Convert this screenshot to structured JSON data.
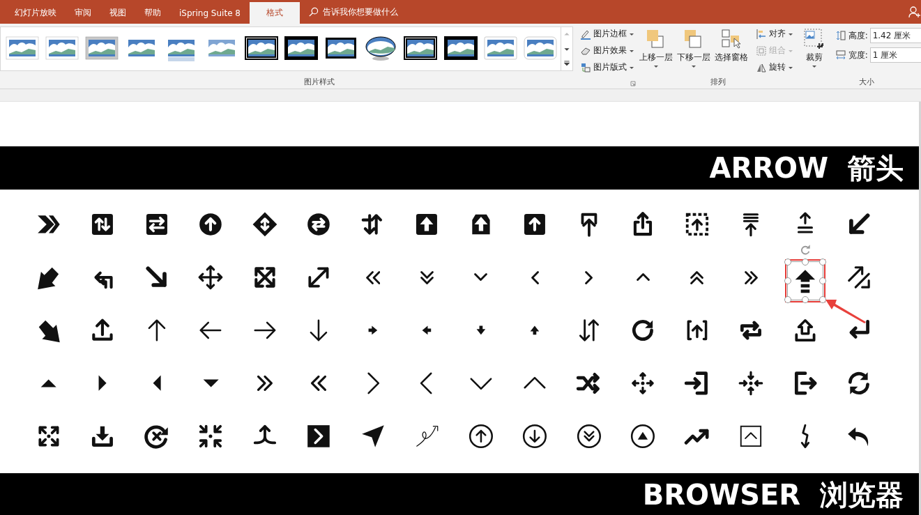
{
  "tabs": [
    {
      "label": "幻灯片放映",
      "selected": false
    },
    {
      "label": "审阅",
      "selected": false
    },
    {
      "label": "视图",
      "selected": false
    },
    {
      "label": "帮助",
      "selected": false
    },
    {
      "label": "iSpring Suite 8",
      "selected": false
    },
    {
      "label": "格式",
      "selected": true
    }
  ],
  "tell_me": {
    "placeholder": "告诉我你想要做什么"
  },
  "ribbon": {
    "picture_styles": {
      "label": "图片样式",
      "styles": [
        {
          "kind": "shadow"
        },
        {
          "kind": "white-frame"
        },
        {
          "kind": "gray-matte"
        },
        {
          "kind": "top-shadow"
        },
        {
          "kind": "reflection"
        },
        {
          "kind": "soft-edge"
        },
        {
          "kind": "double-black"
        },
        {
          "kind": "thick-black"
        },
        {
          "kind": "thin-black"
        },
        {
          "kind": "oval"
        },
        {
          "kind": "double-black"
        },
        {
          "kind": "thick-black"
        },
        {
          "kind": "plain"
        },
        {
          "kind": "rounded"
        }
      ],
      "commands": [
        {
          "label": "图片边框",
          "kind": "border"
        },
        {
          "label": "图片效果",
          "kind": "effects"
        },
        {
          "label": "图片版式",
          "kind": "layout"
        }
      ]
    },
    "arrange": {
      "label": "排列",
      "layers": [
        {
          "label": "上移一层",
          "kind": "forward"
        },
        {
          "label": "下移一层",
          "kind": "backward"
        },
        {
          "label": "选择窗格",
          "kind": "pane"
        }
      ],
      "commands": [
        {
          "label": "对齐",
          "kind": "align",
          "disabled": false
        },
        {
          "label": "组合",
          "kind": "group",
          "disabled": true
        },
        {
          "label": "旋转",
          "kind": "rotate",
          "disabled": false
        }
      ]
    },
    "size": {
      "label": "大小",
      "crop": {
        "label": "裁剪"
      },
      "fields": [
        {
          "label": "高度:",
          "value": "1.42 厘米",
          "kind": "height"
        },
        {
          "label": "宽度:",
          "value": "1 厘米",
          "kind": "width"
        }
      ]
    }
  },
  "slide": {
    "top_banner": {
      "title": "ARROW  箭头"
    },
    "icon_rows": [
      {
        "icons": [
          {
            "selected": false
          },
          {
            "selected": false
          },
          {
            "selected": false
          },
          {
            "selected": false
          },
          {
            "selected": false
          },
          {
            "selected": false
          },
          {
            "selected": false
          },
          {
            "selected": false
          },
          {
            "selected": false
          },
          {
            "selected": false
          },
          {
            "selected": false
          },
          {
            "selected": false
          },
          {
            "selected": false
          },
          {
            "selected": false
          },
          {
            "selected": false
          },
          {
            "selected": false
          }
        ]
      },
      {
        "icons": [
          {
            "selected": false
          },
          {
            "selected": false
          },
          {
            "selected": false
          },
          {
            "selected": false
          },
          {
            "selected": false
          },
          {
            "selected": false
          },
          {
            "selected": false
          },
          {
            "selected": false
          },
          {
            "selected": false
          },
          {
            "selected": false
          },
          {
            "selected": false
          },
          {
            "selected": false
          },
          {
            "selected": false
          },
          {
            "selected": false
          },
          {
            "selected": true
          },
          {
            "selected": false
          }
        ]
      },
      {
        "icons": [
          {
            "selected": false
          },
          {
            "selected": false
          },
          {
            "selected": false
          },
          {
            "selected": false
          },
          {
            "selected": false
          },
          {
            "selected": false
          },
          {
            "selected": false
          },
          {
            "selected": false
          },
          {
            "selected": false
          },
          {
            "selected": false
          },
          {
            "selected": false
          },
          {
            "selected": false
          },
          {
            "selected": false
          },
          {
            "selected": false
          },
          {
            "selected": false
          },
          {
            "selected": false
          }
        ]
      },
      {
        "icons": [
          {
            "selected": false
          },
          {
            "selected": false
          },
          {
            "selected": false
          },
          {
            "selected": false
          },
          {
            "selected": false
          },
          {
            "selected": false
          },
          {
            "selected": false
          },
          {
            "selected": false
          },
          {
            "selected": false
          },
          {
            "selected": false
          },
          {
            "selected": false
          },
          {
            "selected": false
          },
          {
            "selected": false
          },
          {
            "selected": false
          },
          {
            "selected": false
          },
          {
            "selected": false
          }
        ]
      },
      {
        "icons": [
          {
            "selected": false
          },
          {
            "selected": false
          },
          {
            "selected": false
          },
          {
            "selected": false
          },
          {
            "selected": false
          },
          {
            "selected": false
          },
          {
            "selected": false
          },
          {
            "selected": false
          },
          {
            "selected": false
          },
          {
            "selected": false
          },
          {
            "selected": false
          },
          {
            "selected": false
          },
          {
            "selected": false
          },
          {
            "selected": false
          },
          {
            "selected": false
          },
          {
            "selected": false
          }
        ]
      }
    ],
    "bottom_banner": {
      "title": "BROWSER  浏览器"
    }
  }
}
